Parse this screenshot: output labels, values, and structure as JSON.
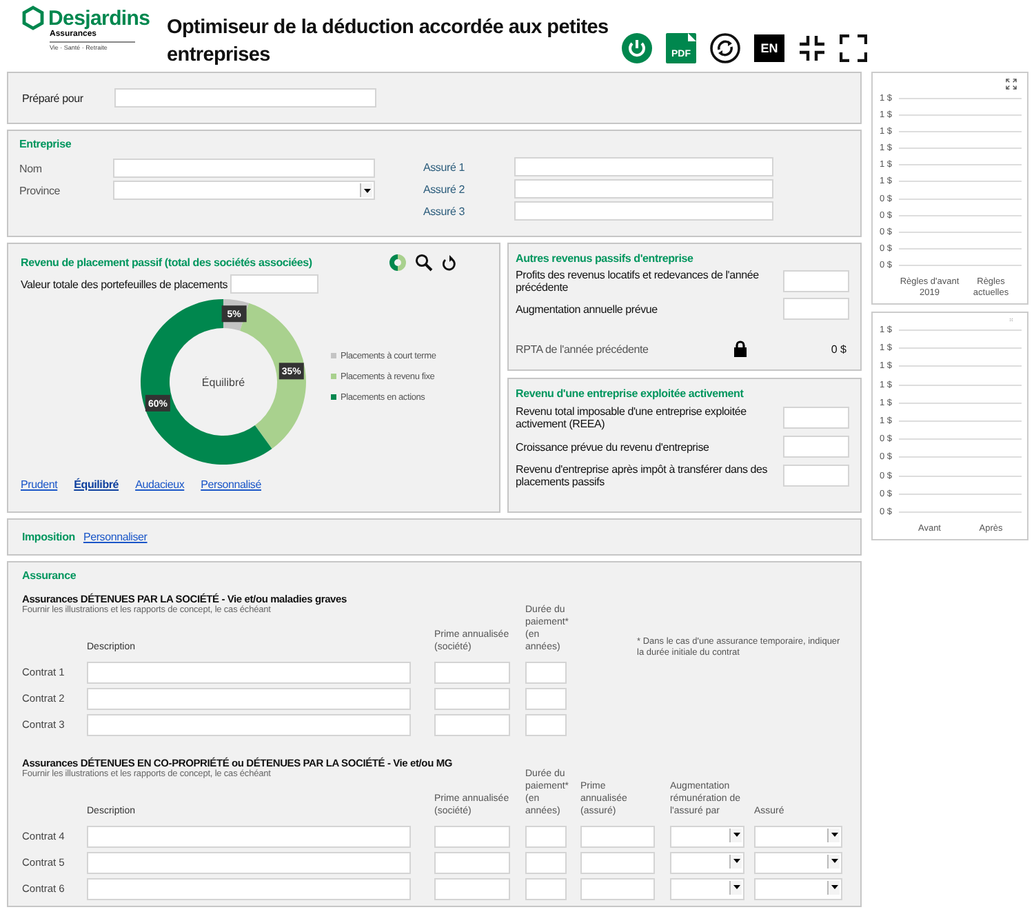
{
  "header": {
    "logo_name": "Desjardins",
    "logo_sub": "Assurances",
    "logo_tagline": "Vie · Santé · Retraite",
    "title": "Optimiseur de la déduction accordée aux petites entreprises",
    "toolbar": [
      {
        "kind": "power"
      },
      {
        "kind": "pdf",
        "label": "PDF"
      },
      {
        "kind": "refresh"
      },
      {
        "kind": "language",
        "label": "EN"
      },
      {
        "kind": "collapse"
      },
      {
        "kind": "expand"
      }
    ]
  },
  "prepared_for": {
    "label": "Préparé pour"
  },
  "company": {
    "title": "Entreprise",
    "fields": [
      {
        "label": "Nom",
        "kind": "text"
      },
      {
        "label": "Province",
        "kind": "select"
      }
    ],
    "insured": [
      {
        "label": "Assuré 1"
      },
      {
        "label": "Assuré 2"
      },
      {
        "label": "Assuré 3"
      }
    ]
  },
  "passive": {
    "title": "Revenu de placement passif (total des sociétés associées)",
    "portfolio_label": "Valeur totale des portefeuilles de placements",
    "center_label": "Équilibré",
    "chart_data": {
      "type": "donut",
      "categories": [
        "Placements à court terme",
        "Placements à revenu fixe",
        "Placements en actions"
      ],
      "values": [
        5,
        35,
        60
      ],
      "colors": [
        "#c4c4c4",
        "#a9d18e",
        "#00874e"
      ],
      "data_labels": true,
      "legend": true,
      "value_labels": [
        "5%",
        "35%",
        "60%"
      ]
    },
    "profiles": [
      {
        "label": "Prudent",
        "selected": false
      },
      {
        "label": "Équilibré",
        "selected": true
      },
      {
        "label": "Audacieux",
        "selected": false
      },
      {
        "label": "Personnalisé",
        "selected": false
      }
    ]
  },
  "other_passive": {
    "title": "Autres revenus passifs d'entreprise",
    "fields": [
      {
        "label": "Profits des revenus locatifs et redevances de l'année précédente",
        "kind": "input"
      },
      {
        "label": "Augmentation annuelle prévue",
        "kind": "input"
      },
      {
        "label": "RPTA de l'année précédente",
        "kind": "locked",
        "value": "0 $"
      }
    ]
  },
  "active": {
    "title": "Revenu d'une entreprise exploitée activement",
    "fields": [
      {
        "label": "Revenu total imposable d'une entreprise exploitée activement (REEA)",
        "kind": "input"
      },
      {
        "label": "Croissance prévue du revenu d'entreprise",
        "kind": "input"
      },
      {
        "label": "Revenu d'entreprise après impôt à transférer dans des placements passifs",
        "kind": "input"
      }
    ]
  },
  "taxation": {
    "title": "Imposition",
    "link": "Personnaliser"
  },
  "insurance": {
    "title": "Assurance",
    "tables": [
      {
        "title": "Assurances DÉTENUES PAR LA SOCIÉTÉ - Vie et/ou maladies graves",
        "note": "Fournir les illustrations et les rapports de concept, le cas échéant",
        "footnote": "* Dans le cas d'une assurance temporaire, indiquer la durée initiale du contrat",
        "columns": [
          {
            "label": "Description",
            "kind": "text"
          },
          {
            "label": "Prime annualisée (société)",
            "kind": "text"
          },
          {
            "label": "Durée du paiement* (en années)",
            "kind": "text"
          }
        ],
        "rows": [
          "Contrat 1",
          "Contrat 2",
          "Contrat 3"
        ]
      },
      {
        "title": "Assurances DÉTENUES EN CO-PROPRIÉTÉ ou DÉTENUES PAR LA SOCIÉTÉ - Vie et/ou MG",
        "note": "Fournir les illustrations et les rapports de concept, le cas échéant",
        "columns": [
          {
            "label": "Description",
            "kind": "text"
          },
          {
            "label": "Prime annualisée (société)",
            "kind": "text"
          },
          {
            "label": "Durée du paiement* (en années)",
            "kind": "text"
          },
          {
            "label": "Prime annualisée (assuré)",
            "kind": "text"
          },
          {
            "label": "Augmentation rémunération de l'assuré par",
            "kind": "select"
          },
          {
            "label": "Assuré",
            "kind": "select"
          }
        ],
        "rows": [
          "Contrat 4",
          "Contrat 5",
          "Contrat 6"
        ]
      }
    ]
  },
  "charts": [
    {
      "axis_labels": [
        "1 $",
        "1 $",
        "1 $",
        "1 $",
        "1 $",
        "1 $",
        "0 $",
        "0 $",
        "0 $",
        "0 $",
        "0 $"
      ],
      "categories": [
        "Règles d'avant 2019",
        "Règles actuelles"
      ]
    },
    {
      "axis_labels": [
        "1 $",
        "1 $",
        "1 $",
        "1 $",
        "1 $",
        "1 $",
        "0 $",
        "0 $",
        "0 $",
        "0 $",
        "0 $"
      ],
      "categories": [
        "Avant",
        "Après"
      ]
    }
  ]
}
